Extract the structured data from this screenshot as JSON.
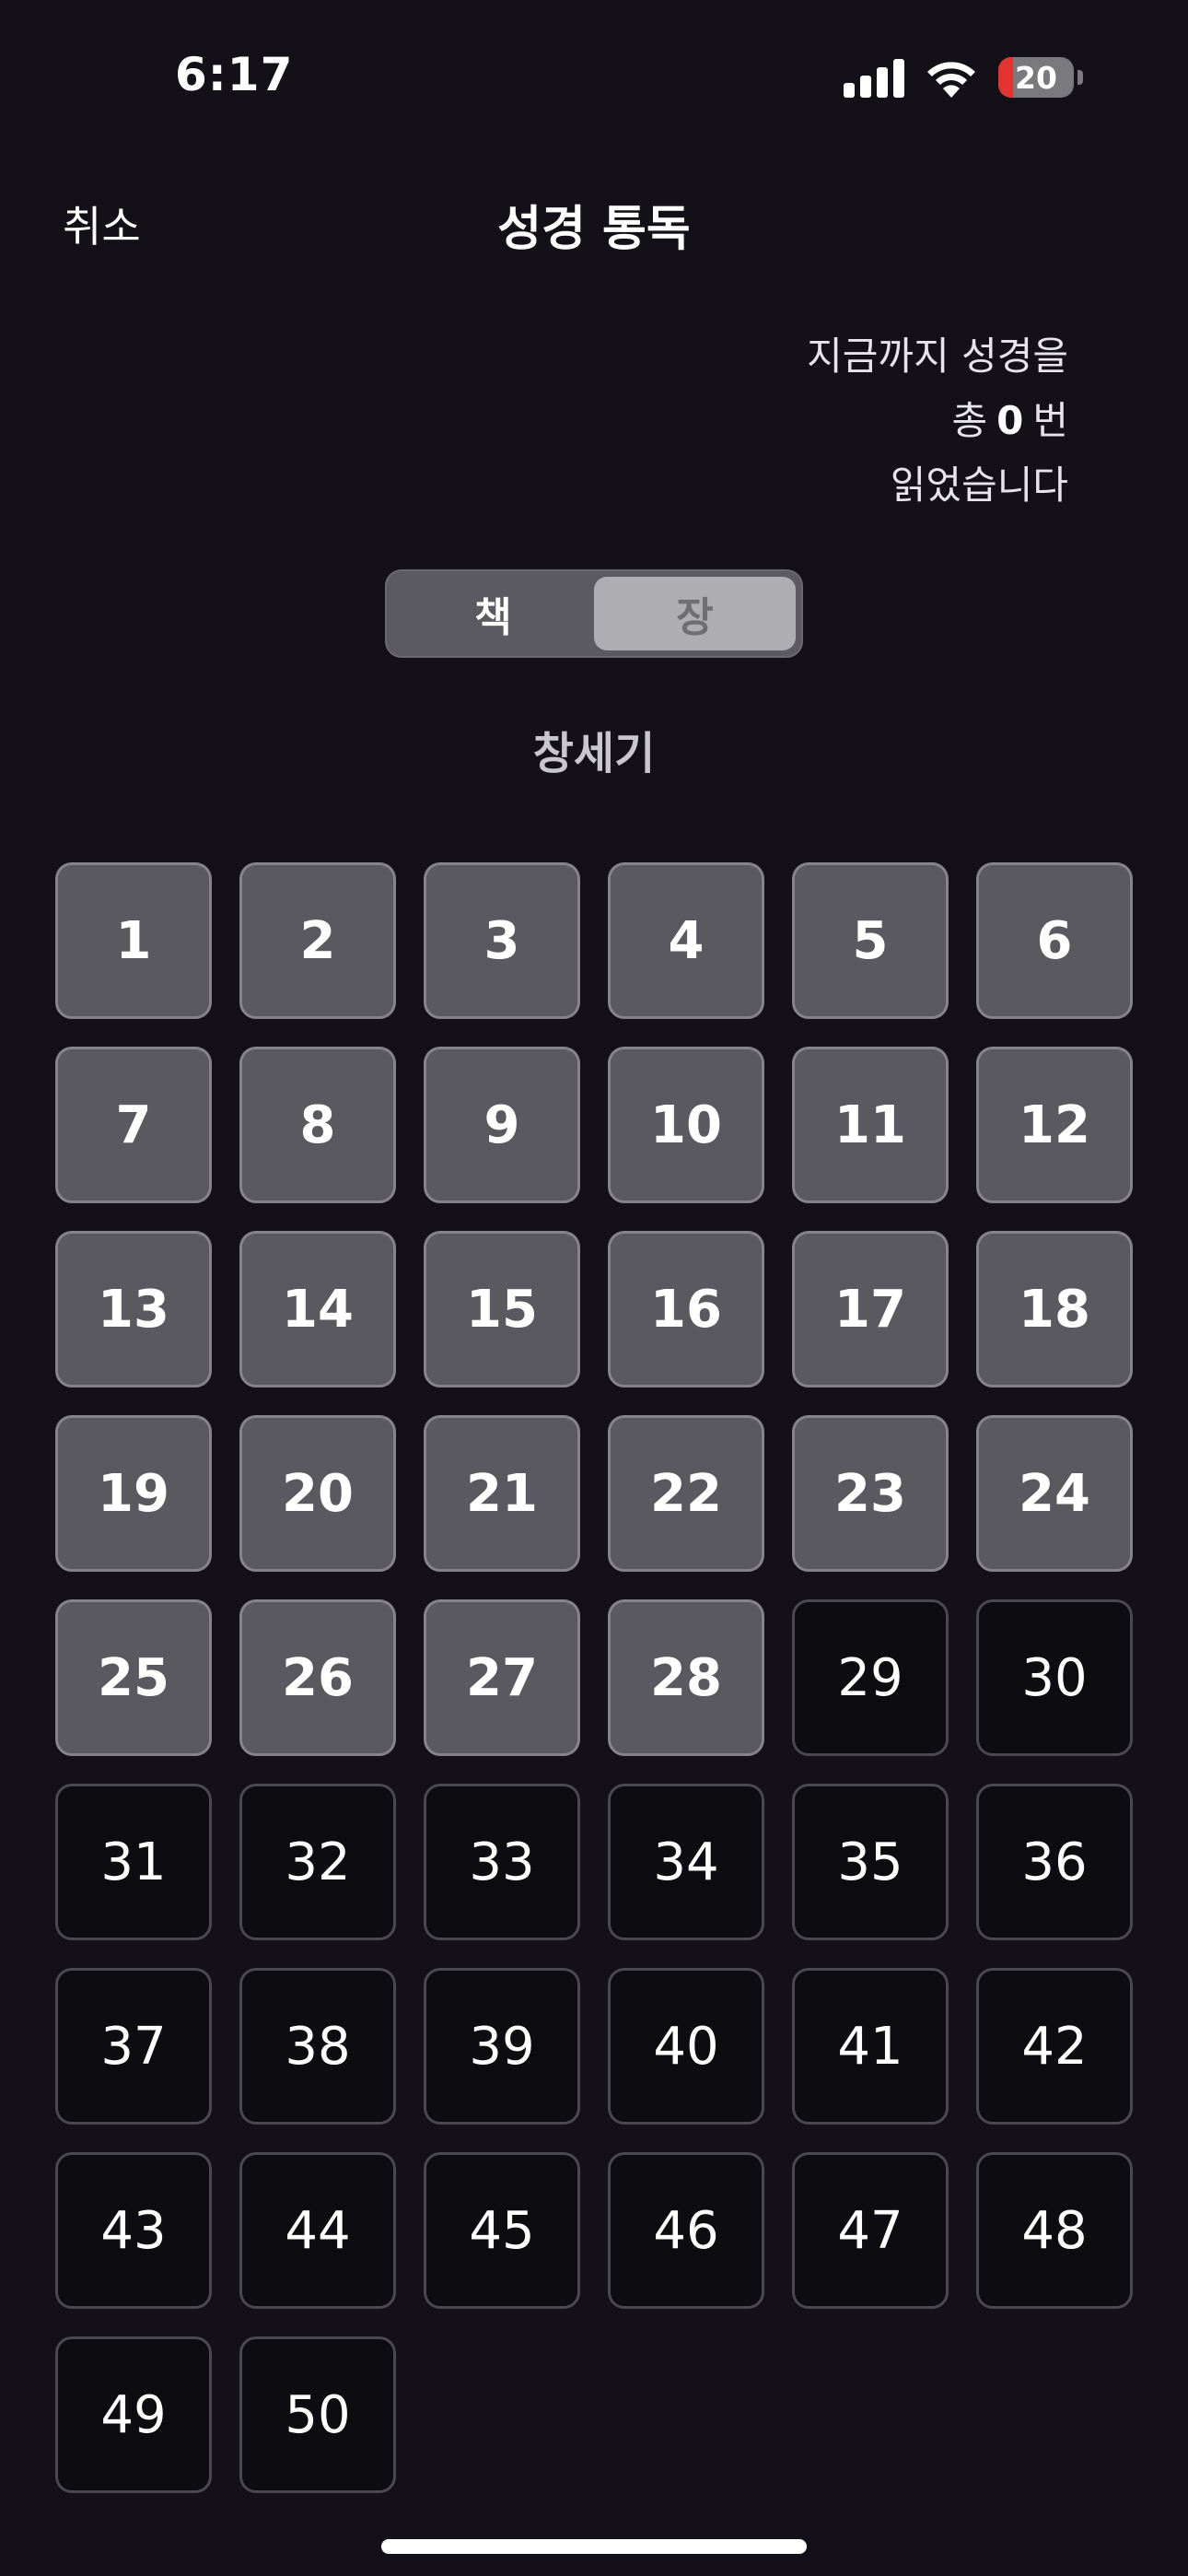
{
  "status_bar": {
    "time": "6:17",
    "battery_level": "20",
    "icons": [
      "cellular-signal-icon",
      "wifi-icon",
      "battery-icon"
    ]
  },
  "nav": {
    "cancel_label": "취소",
    "title": "성경 통독"
  },
  "summary": {
    "line1": "지금까지 성경을",
    "prefix": "총",
    "count": "0",
    "suffix": "번",
    "line3": "읽었습니다"
  },
  "segmented": {
    "book_label": "책",
    "chapter_label": "장",
    "selected": "장"
  },
  "book_title": "창세기",
  "colors": {
    "background": "#131117",
    "read_cell": "#5a595f",
    "unread_cell": "#0d0c10",
    "battery_low": "#e5342f"
  },
  "chapters": [
    {
      "number": "1",
      "read": true
    },
    {
      "number": "2",
      "read": true
    },
    {
      "number": "3",
      "read": true
    },
    {
      "number": "4",
      "read": true
    },
    {
      "number": "5",
      "read": true
    },
    {
      "number": "6",
      "read": true
    },
    {
      "number": "7",
      "read": true
    },
    {
      "number": "8",
      "read": true
    },
    {
      "number": "9",
      "read": true
    },
    {
      "number": "10",
      "read": true
    },
    {
      "number": "11",
      "read": true
    },
    {
      "number": "12",
      "read": true
    },
    {
      "number": "13",
      "read": true
    },
    {
      "number": "14",
      "read": true
    },
    {
      "number": "15",
      "read": true
    },
    {
      "number": "16",
      "read": true
    },
    {
      "number": "17",
      "read": true
    },
    {
      "number": "18",
      "read": true
    },
    {
      "number": "19",
      "read": true
    },
    {
      "number": "20",
      "read": true
    },
    {
      "number": "21",
      "read": true
    },
    {
      "number": "22",
      "read": true
    },
    {
      "number": "23",
      "read": true
    },
    {
      "number": "24",
      "read": true
    },
    {
      "number": "25",
      "read": true
    },
    {
      "number": "26",
      "read": true
    },
    {
      "number": "27",
      "read": true
    },
    {
      "number": "28",
      "read": true
    },
    {
      "number": "29",
      "read": false
    },
    {
      "number": "30",
      "read": false
    },
    {
      "number": "31",
      "read": false
    },
    {
      "number": "32",
      "read": false
    },
    {
      "number": "33",
      "read": false
    },
    {
      "number": "34",
      "read": false
    },
    {
      "number": "35",
      "read": false
    },
    {
      "number": "36",
      "read": false
    },
    {
      "number": "37",
      "read": false
    },
    {
      "number": "38",
      "read": false
    },
    {
      "number": "39",
      "read": false
    },
    {
      "number": "40",
      "read": false
    },
    {
      "number": "41",
      "read": false
    },
    {
      "number": "42",
      "read": false
    },
    {
      "number": "43",
      "read": false
    },
    {
      "number": "44",
      "read": false
    },
    {
      "number": "45",
      "read": false
    },
    {
      "number": "46",
      "read": false
    },
    {
      "number": "47",
      "read": false
    },
    {
      "number": "48",
      "read": false
    },
    {
      "number": "49",
      "read": false
    },
    {
      "number": "50",
      "read": false
    }
  ]
}
